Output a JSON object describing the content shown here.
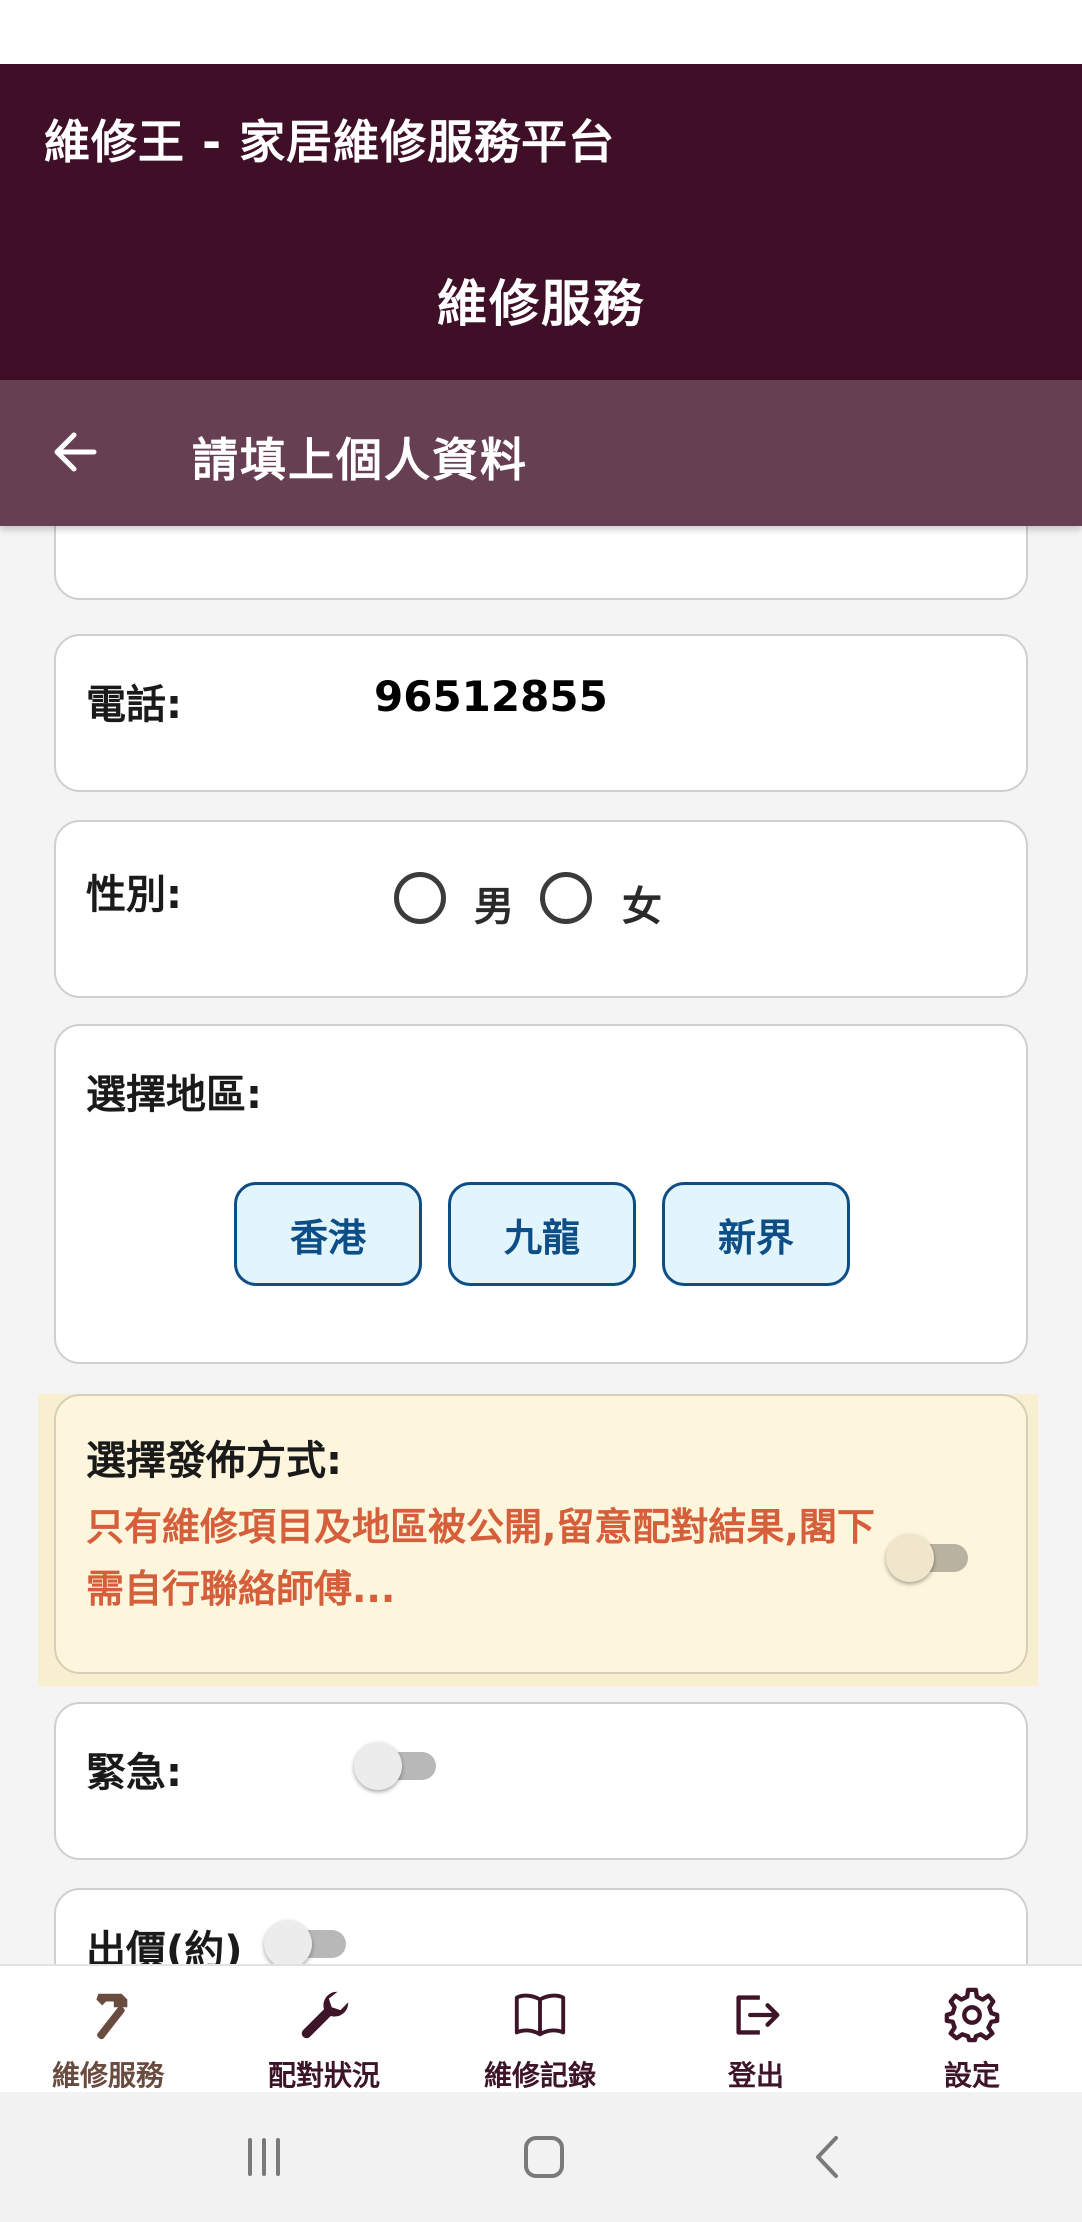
{
  "app": {
    "title": "維修王 - 家居維修服務平台",
    "page_title": "維修服務",
    "colors": {
      "primary": "#3e0f27",
      "secondary": "#673f52",
      "accent_blue": "#0e4e87",
      "warning_text": "#d45f3a",
      "warning_bg": "#fdf5dc"
    }
  },
  "subheader": {
    "back_icon": "arrow-left-icon",
    "title": "請填上個人資料"
  },
  "form": {
    "phone": {
      "label": "電話:",
      "value": "96512855"
    },
    "gender": {
      "label": "性別:",
      "options": [
        "男",
        "女"
      ]
    },
    "region": {
      "label": "選擇地區:",
      "options": [
        "香港",
        "九龍",
        "新界"
      ]
    },
    "publish": {
      "label": "選擇發佈方式:",
      "description": "只有維修項目及地區被公開,留意配對結果,閣下需自行聯絡師傅...",
      "toggle_on": false
    },
    "urgent": {
      "label": "緊急:",
      "toggle_on": false
    },
    "price": {
      "label": "出價(約)",
      "toggle_on": false
    }
  },
  "bottom_nav": {
    "items": [
      {
        "label": "維修服務",
        "icon": "hammer-icon",
        "active": true
      },
      {
        "label": "配對狀況",
        "icon": "wrench-icon",
        "active": false
      },
      {
        "label": "維修記錄",
        "icon": "book-icon",
        "active": false
      },
      {
        "label": "登出",
        "icon": "logout-icon",
        "active": false
      },
      {
        "label": "設定",
        "icon": "gear-icon",
        "active": false
      }
    ]
  },
  "system_nav": {
    "buttons": [
      "recent-apps-icon",
      "home-icon",
      "back-icon"
    ]
  }
}
